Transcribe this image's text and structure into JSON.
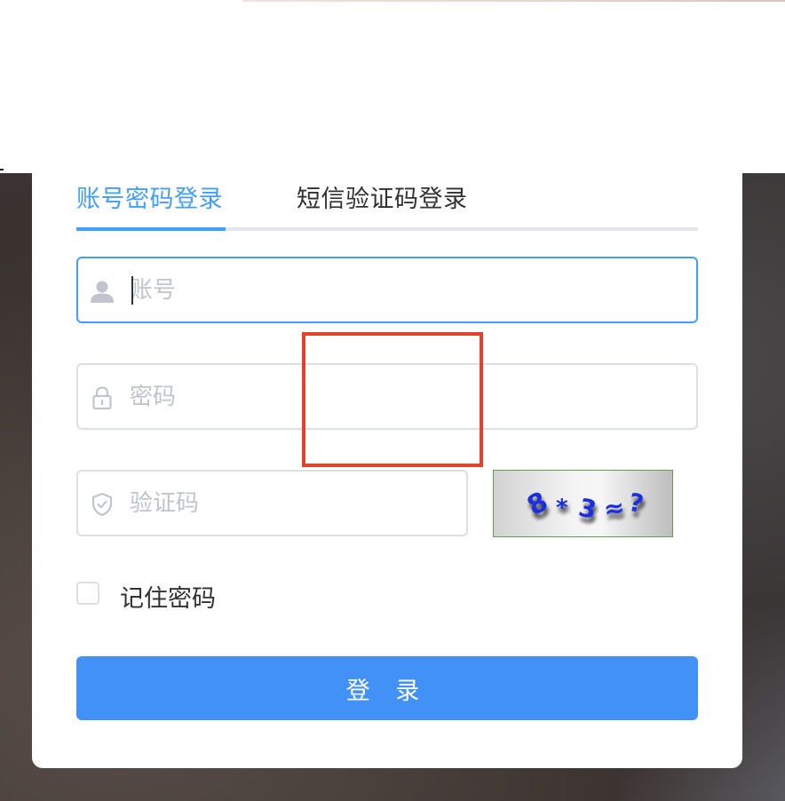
{
  "login": {
    "tabs": [
      {
        "label": "账号密码登录",
        "active": true
      },
      {
        "label": "短信验证码登录",
        "active": false
      }
    ],
    "username": {
      "placeholder": "账号",
      "value": ""
    },
    "password": {
      "placeholder": "密码",
      "value": ""
    },
    "captcha_input": {
      "placeholder": "验证码",
      "value": ""
    },
    "captcha_image": {
      "text": "8*3≈?"
    },
    "remember": {
      "label": "记住密码",
      "checked": false
    },
    "submit_label": "登 录"
  },
  "colors": {
    "accent": "#409eff",
    "button": "#4291f7",
    "highlight_box": "#e2432a"
  }
}
